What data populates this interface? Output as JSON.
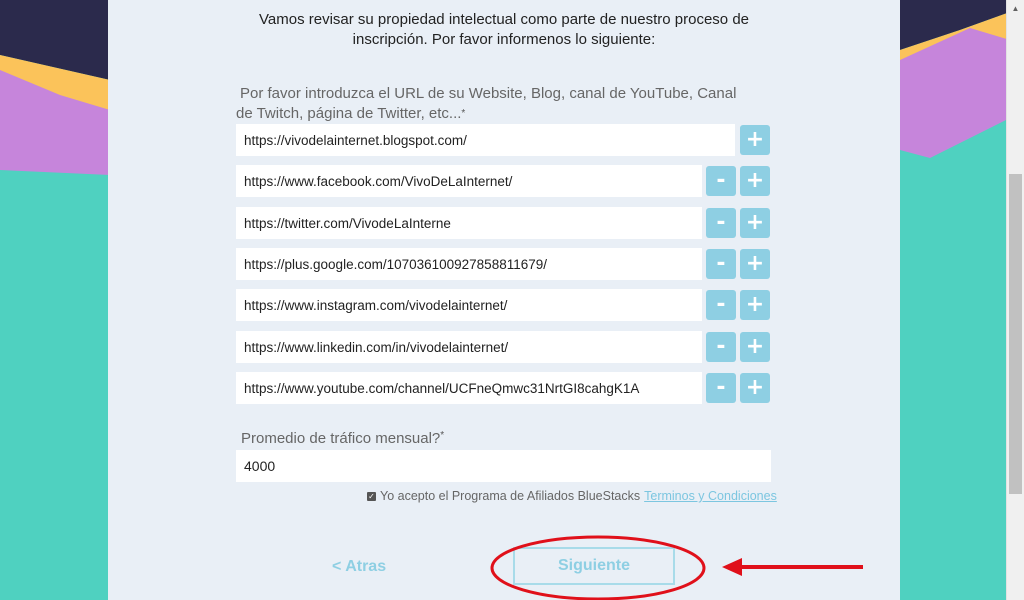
{
  "intro": {
    "line1": "Vamos revisar su propiedad intelectual como parte de nuestro proceso de",
    "line2": "inscripción. Por favor informenos lo siguiente:"
  },
  "url_section": {
    "label_line1": "Por favor introduzca el URL de su Website, Blog, canal de YouTube, Canal",
    "label_line2": "de Twitch, página de Twitter, etc...",
    "required_mark": "*",
    "urls": [
      "https://vivodelainternet.blogspot.com/",
      "https://www.facebook.com/VivoDeLaInternet/",
      "https://twitter.com/VivodeLaInterne",
      "https://plus.google.com/107036100927858811679/",
      "https://www.instagram.com/vivodelainternet/",
      "https://www.linkedin.com/in/vivodelainternet/",
      "https://www.youtube.com/channel/UCFneQmwc31NrtGI8cahgK1A"
    ],
    "add_label": "+",
    "remove_label": "-"
  },
  "traffic": {
    "label": "Promedio de tráfico mensual?",
    "required_mark": "*",
    "value": "4000"
  },
  "terms": {
    "checked": true,
    "text": "Yo acepto el Programa de Afiliados BlueStacks",
    "link": "Terminos y Condiciones"
  },
  "nav": {
    "back_label": "< Atras",
    "next_label": "Siguiente"
  },
  "colors": {
    "accent": "#8ecfe3",
    "annotation": "#e0101a",
    "panel": "#e9eff6",
    "teal": "#4fd1c0",
    "navy": "#2b2a4c",
    "purple": "#c685db",
    "yellow": "#fbc35a"
  }
}
